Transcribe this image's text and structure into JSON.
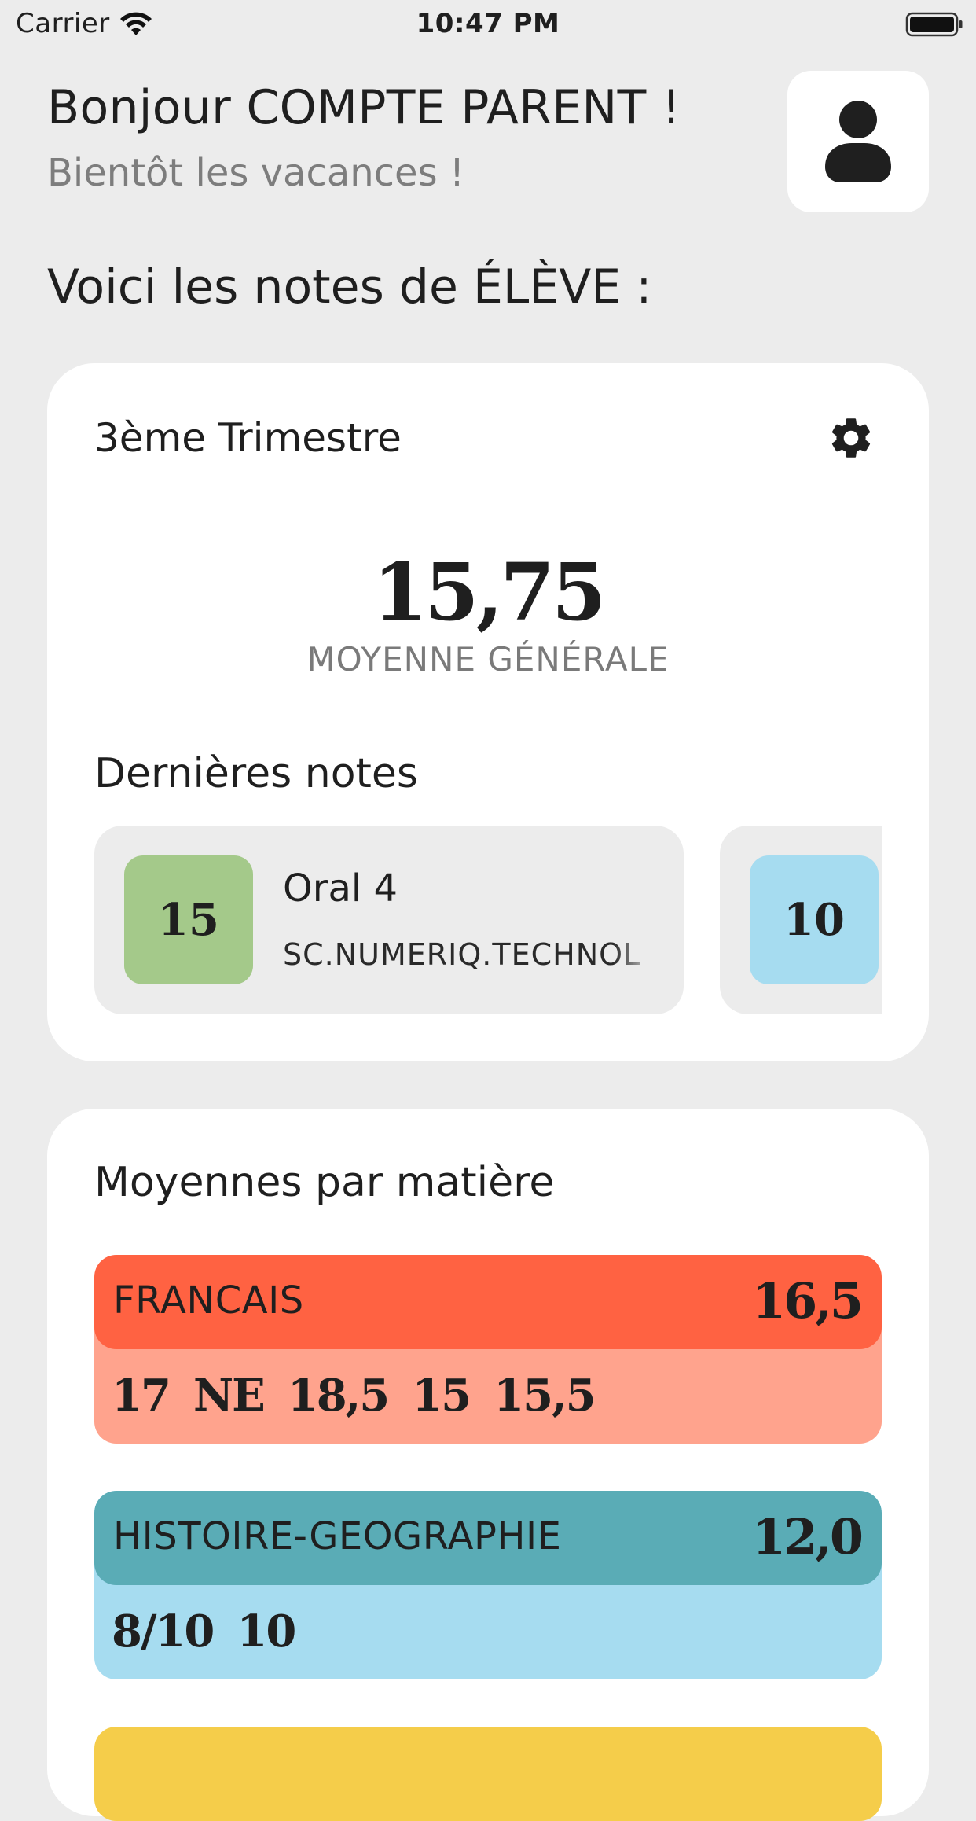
{
  "status_bar": {
    "carrier": "Carrier",
    "time": "10:47 PM",
    "wifi_icon": "wifi-icon",
    "battery_icon": "battery-icon"
  },
  "header": {
    "greeting": "Bonjour COMPTE PARENT !",
    "subtitle": "Bientôt les vacances !",
    "profile_icon": "user-icon"
  },
  "notes_title": "Voici les notes de ÉLÈVE :",
  "trimester": {
    "label": "3ème Trimestre",
    "settings_icon": "gear-icon",
    "average": "15,75",
    "average_label": "MOYENNE GÉNÉRALE"
  },
  "recent_notes": {
    "title": "Dernières notes",
    "items": [
      {
        "grade": "15",
        "name": "Oral 4",
        "subject": "SC.NUMERIQ.TECHNOL",
        "color": "#a4c98a"
      },
      {
        "grade": "10",
        "name": "",
        "subject": "",
        "color": "#a6dcf0"
      }
    ]
  },
  "subjects": {
    "title": "Moyennes par matière",
    "items": [
      {
        "name": "FRANCAIS",
        "average": "16,5",
        "grades": [
          "17",
          "NE",
          "18,5",
          "15",
          "15,5"
        ],
        "head_color": "#ff6242",
        "body_color": "#ffa38d"
      },
      {
        "name": "HISTOIRE-GEOGRAPHIE",
        "average": "12,0",
        "grades": [
          "8/10",
          "10"
        ],
        "head_color": "#5aacb6",
        "body_color": "#a6dcf0"
      }
    ],
    "next_color": "#f5cd4a"
  }
}
